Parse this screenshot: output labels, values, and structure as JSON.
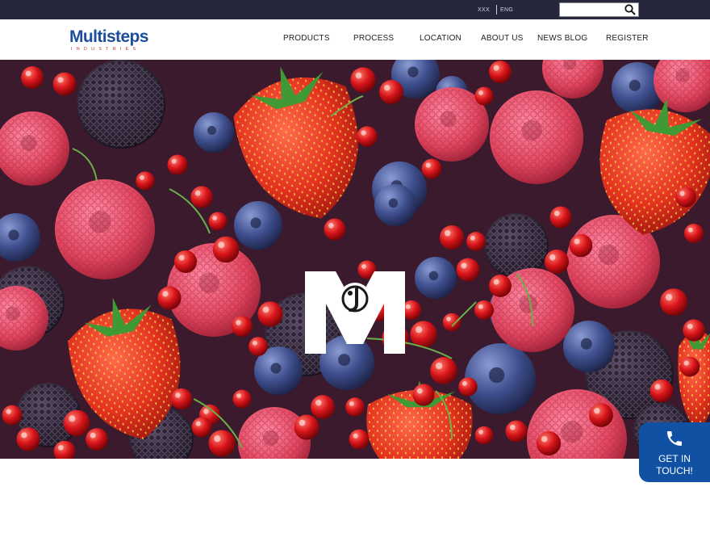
{
  "topbar": {
    "lang_primary": "XXX",
    "lang_secondary": "ENG",
    "search": {
      "value": "",
      "placeholder": ""
    }
  },
  "brand": {
    "name": "Multisteps",
    "tagline": "INDUSTRIES",
    "colors": {
      "primary": "#1d4e9e",
      "accent": "#c0392b"
    }
  },
  "nav": {
    "items": [
      {
        "label": "PRODUCTS"
      },
      {
        "label": "PROCESS"
      },
      {
        "label": "LOCATION"
      },
      {
        "label": "ABOUT US"
      },
      {
        "label": "NEWS BLOG"
      },
      {
        "label": "REGISTER"
      }
    ]
  },
  "hero": {
    "image": "mixed berries background (strawberries, raspberries, blueberries, blackberries, redcurrants)",
    "emblem_letter": "M",
    "carousel": {
      "slides": 3,
      "active_index": 0
    }
  },
  "contact": {
    "icon": "phone-icon",
    "line1": "GET IN",
    "line2": "TOUCH!"
  },
  "icons": {
    "search": "search-icon",
    "phone": "phone-icon"
  }
}
